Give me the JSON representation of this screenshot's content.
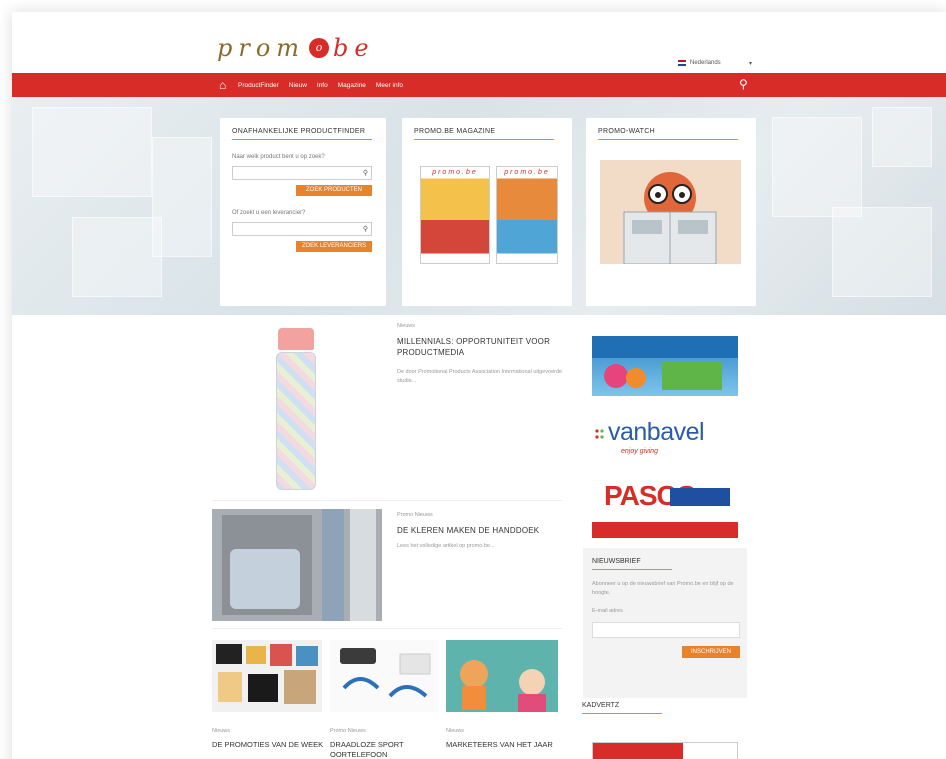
{
  "header": {
    "logo_text_left": "prom",
    "logo_text_dot": "o",
    "logo_text_right": "be",
    "language": "Nederlands"
  },
  "nav": {
    "items": [
      "ProductFinder",
      "Nieuw",
      "Info",
      "Magazine",
      "Meer info"
    ]
  },
  "hero": {
    "card1": {
      "title": "ONAFHANKELIJKE PRODUCTFINDER",
      "label1": "Naar welk product bent u op zoek?",
      "button1": "ZOEK PRODUCTEN",
      "label2": "Of zoekt u een leverancier?",
      "button2": "ZOEK LEVERANCIERS"
    },
    "card2": {
      "title": "PROMO.BE MAGAZINE",
      "cover_text": "promo.be"
    },
    "card3": {
      "title": "PROMO-WATCH"
    }
  },
  "posts": [
    {
      "meta": "Nieuws",
      "title": "MILLENNIALS: OPPORTUNITEIT VOOR PRODUCTMEDIA",
      "excerpt": "De door Promotional Products Association International uitgevoerde studie..."
    },
    {
      "meta": "Promo Nieuws",
      "title": "DE KLEREN MAKEN DE HANDDOEK",
      "excerpt": "Lees het volledige artikel op promo.be..."
    }
  ],
  "bottom_posts": [
    {
      "meta": "Nieuws",
      "title": "DE PROMOTIES VAN DE WEEK"
    },
    {
      "meta": "Promo Nieuws",
      "title": "DRAADLOZE SPORT OORTELEFOON"
    },
    {
      "meta": "Nieuws",
      "title": "MARKETEERS VAN HET JAAR"
    }
  ],
  "sidebar": {
    "vanbavel_text": "vanbavel",
    "vanbavel_tagline": "enjoy giving",
    "pasco_text": "PASCO",
    "newsletter": {
      "title": "NIEUWSBRIEF",
      "text": "Abonneer u op de nieuwsbrief van Promo.be en blijf op de hoogte.",
      "email_label": "E-mail adres",
      "button": "INSCHRIJVEN"
    },
    "kadvertz": "KADVERTZ"
  },
  "colors": {
    "brand_red": "#d72c27",
    "accent_orange": "#e8822b",
    "logo_gold": "#8a6b2e"
  }
}
